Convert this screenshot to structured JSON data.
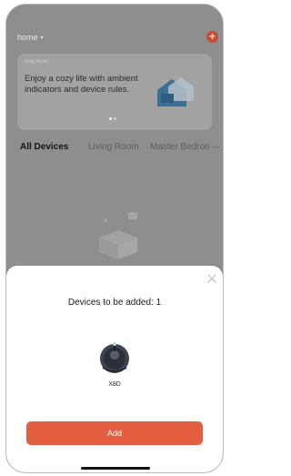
{
  "header": {
    "home_name": "home",
    "caret": "▾",
    "add_icon": "+"
  },
  "banner": {
    "tag": "Cozy Home",
    "text": "Enjoy a cozy life with ambient indicators and device rules."
  },
  "rooms": {
    "tabs": [
      "All Devices",
      "Living Room",
      "Master Bedroo"
    ],
    "more": "···"
  },
  "sheet": {
    "title": "Devices to be added: 1",
    "device_name": "X8D",
    "add_label": "Add"
  },
  "colors": {
    "accent": "#e35f40",
    "overlay": "#8e8e8e"
  }
}
